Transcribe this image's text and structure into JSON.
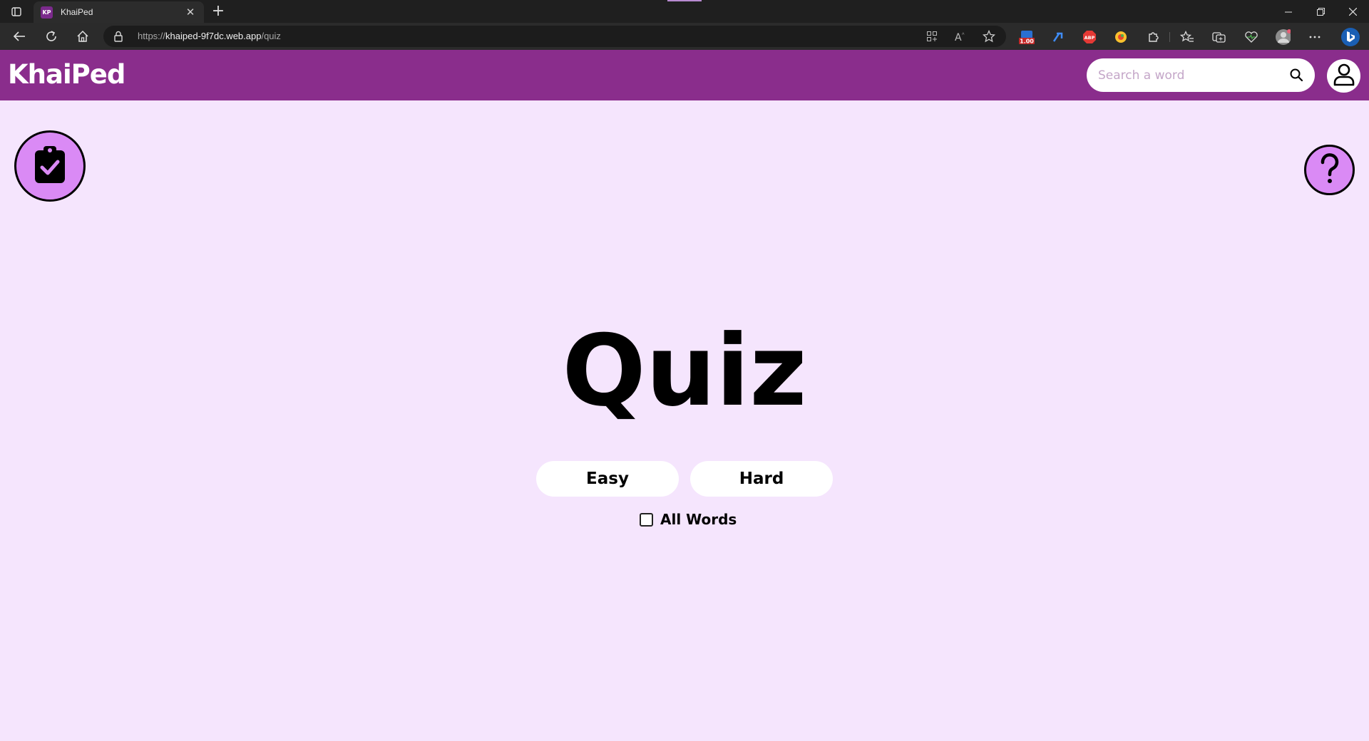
{
  "browser": {
    "tab": {
      "favicon_text": "KP",
      "title": "KhaiPed"
    },
    "url": {
      "scheme": "https://",
      "host": "khaiped-9f7dc.web.app",
      "path": "/quiz"
    },
    "extension_badge": "1.00",
    "adblock_label": "ABP"
  },
  "app": {
    "logo": "KhaiPed",
    "search": {
      "placeholder": "Search a word",
      "value": ""
    },
    "colors": {
      "header": "#8a2d8c",
      "background": "#f5e5fd",
      "accent_circle": "#da8af5"
    }
  },
  "main": {
    "title": "Quiz",
    "buttons": {
      "easy": "Easy",
      "hard": "Hard"
    },
    "all_words": {
      "label": "All Words",
      "checked": false
    }
  },
  "icons": {
    "left_circle": "clipboard-check-icon",
    "right_circle": "question-mark-icon",
    "profile": "user-icon",
    "search": "search-icon"
  }
}
